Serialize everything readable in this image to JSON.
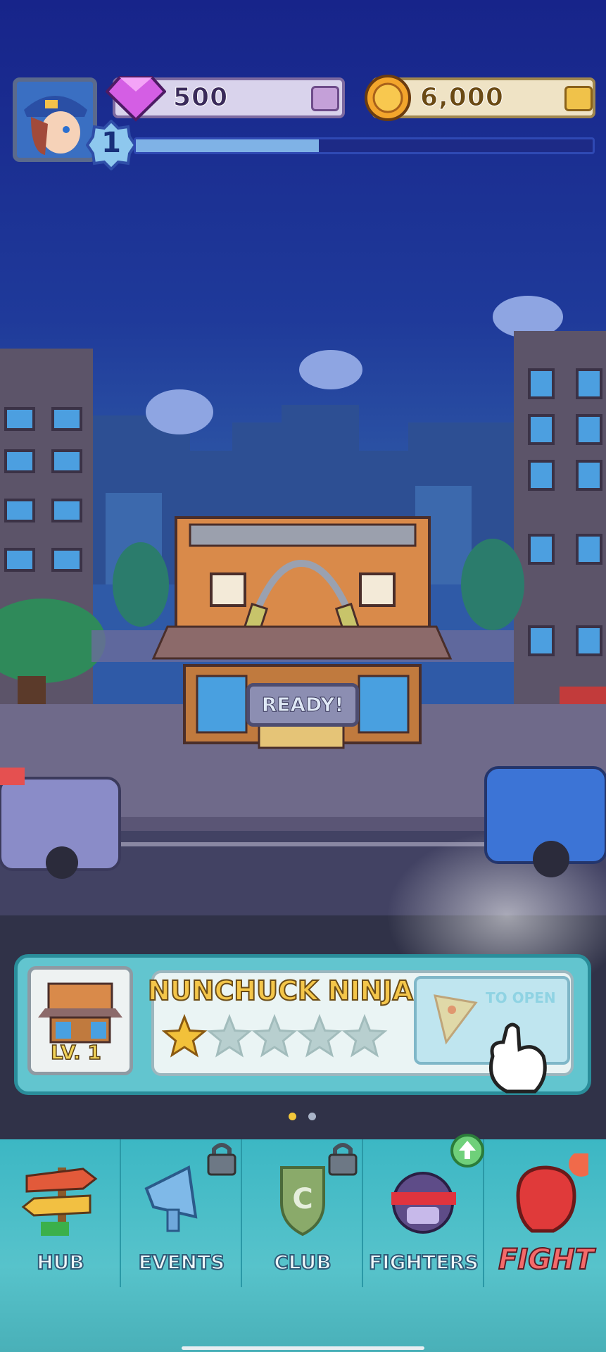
{
  "hud": {
    "level": "1",
    "xp_fraction": 0.4,
    "gems": "500",
    "coins": "6,000"
  },
  "scene": {
    "status_sign": "READY!"
  },
  "building_card": {
    "title": "NUNCHUCK NINJA",
    "level_label": "LV. 1",
    "stars_filled": 1,
    "stars_total": 5,
    "open_button_label": "TO OPEN"
  },
  "pager": {
    "pages": 2,
    "active": 0
  },
  "nav": {
    "items": [
      {
        "label": "HUB",
        "icon": "signpost-icon"
      },
      {
        "label": "EVENTS",
        "icon": "megaphone-icon",
        "locked": true
      },
      {
        "label": "CLUB",
        "icon": "club-shield-icon",
        "locked": true
      },
      {
        "label": "FIGHTERS",
        "icon": "ninja-head-icon",
        "badge": "upgrade"
      },
      {
        "label": "FIGHT",
        "icon": "boxing-glove-icon"
      }
    ]
  },
  "colors": {
    "sky": "#1b2a8c",
    "card": "#62c5cf",
    "nav": "#3cb7c4",
    "title_gold": "#f4c64a",
    "fight_red": "#f56a6a"
  }
}
